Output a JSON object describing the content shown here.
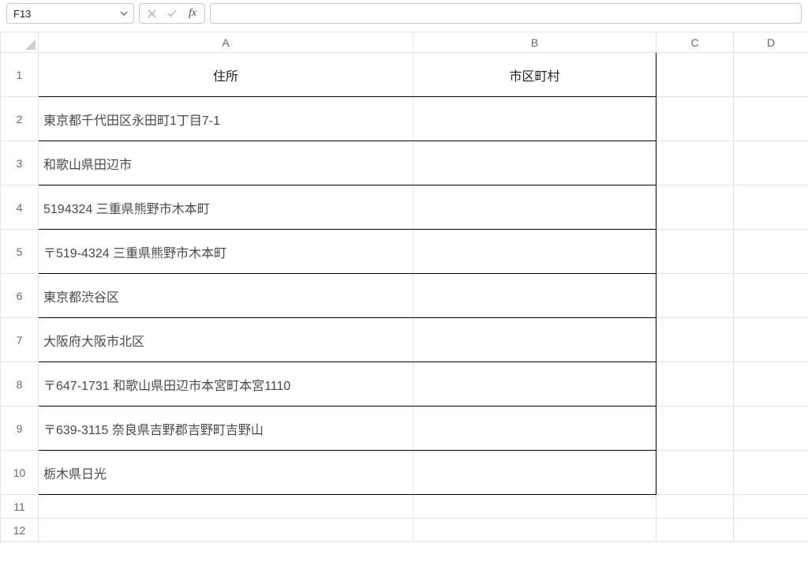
{
  "nameBox": {
    "value": "F13"
  },
  "formulaBar": {
    "value": ""
  },
  "fxLabel": "fx",
  "columns": [
    "A",
    "B",
    "C",
    "D"
  ],
  "rowNumbers": [
    "1",
    "2",
    "3",
    "4",
    "5",
    "6",
    "7",
    "8",
    "9",
    "10",
    "11",
    "12"
  ],
  "header": {
    "A": "住所",
    "B": "市区町村"
  },
  "rows": [
    {
      "A": "東京都千代田区永田町1丁目7-1",
      "B": ""
    },
    {
      "A": "和歌山県田辺市",
      "B": ""
    },
    {
      "A": "5194324 三重県熊野市木本町",
      "B": ""
    },
    {
      "A": "〒519-4324 三重県熊野市木本町",
      "B": ""
    },
    {
      "A": "東京都渋谷区",
      "B": ""
    },
    {
      "A": "大阪府大阪市北区",
      "B": ""
    },
    {
      "A": "〒647-1731 和歌山県田辺市本宮町本宮1110",
      "B": ""
    },
    {
      "A": "〒639-3115 奈良県吉野郡吉野町吉野山",
      "B": ""
    },
    {
      "A": "栃木県日光",
      "B": ""
    }
  ]
}
